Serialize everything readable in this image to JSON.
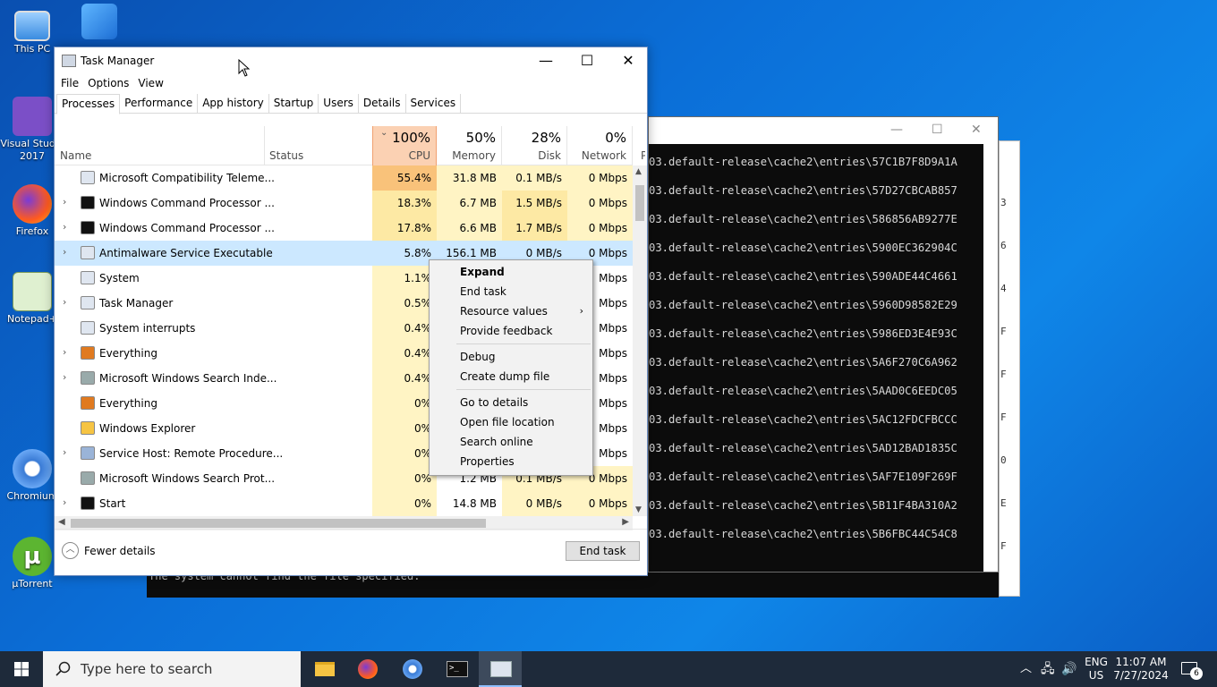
{
  "desktop": {
    "icons": [
      {
        "label": "This PC"
      },
      {
        "label": "Visual Studio 2017"
      },
      {
        "label": "Firefox"
      },
      {
        "label": "Notepad+"
      },
      {
        "label": "Chromium"
      },
      {
        "label": "µTorrent"
      }
    ]
  },
  "console": {
    "lines": [
      "03.default-release\\cache2\\entries\\57C1B7F8D9A1A",
      "03.default-release\\cache2\\entries\\57D27CBCAB857",
      "03.default-release\\cache2\\entries\\586856AB9277E",
      "03.default-release\\cache2\\entries\\5900EC362904C",
      "03.default-release\\cache2\\entries\\590ADE44C4661",
      "03.default-release\\cache2\\entries\\5960D98582E29",
      "03.default-release\\cache2\\entries\\5986ED3E4E93C",
      "03.default-release\\cache2\\entries\\5A6F270C6A962",
      "03.default-release\\cache2\\entries\\5AAD0C6EEDC05",
      "03.default-release\\cache2\\entries\\5AC12FDCFBCCC",
      "03.default-release\\cache2\\entries\\5AD12BAD1835C",
      "03.default-release\\cache2\\entries\\5AF7E109F269F",
      "03.default-release\\cache2\\entries\\5B11F4BA310A2",
      "03.default-release\\cache2\\entries\\5B6FBC44C54C8"
    ],
    "side_chars": [
      "3",
      "6",
      "4",
      "F",
      "F",
      "F",
      "0",
      "E",
      "F"
    ],
    "bottom_text": "The system cannot find the file specified."
  },
  "task_manager": {
    "title": "Task Manager",
    "menu": [
      "File",
      "Options",
      "View"
    ],
    "tabs": [
      "Processes",
      "Performance",
      "App history",
      "Startup",
      "Users",
      "Details",
      "Services"
    ],
    "columns": {
      "name": "Name",
      "status": "Status",
      "cpu_pct": "100%",
      "cpu": "CPU",
      "mem_pct": "50%",
      "mem": "Memory",
      "disk_pct": "28%",
      "disk": "Disk",
      "net_pct": "0%",
      "net": "Network",
      "extra": "P"
    },
    "processes": [
      {
        "name": "Microsoft Compatibility Teleme...",
        "cpu": "55.4%",
        "mem": "31.8 MB",
        "disk": "0.1 MB/s",
        "net": "0 Mbps",
        "expand": false
      },
      {
        "name": "Windows Command Processor ...",
        "cpu": "18.3%",
        "mem": "6.7 MB",
        "disk": "1.5 MB/s",
        "net": "0 Mbps",
        "expand": true
      },
      {
        "name": "Windows Command Processor ...",
        "cpu": "17.8%",
        "mem": "6.6 MB",
        "disk": "1.7 MB/s",
        "net": "0 Mbps",
        "expand": true
      },
      {
        "name": "Antimalware Service Executable",
        "cpu": "5.8%",
        "mem": "156.1 MB",
        "disk": "0 MB/s",
        "net": "0 Mbps",
        "expand": true
      },
      {
        "name": "System",
        "cpu": "1.1%",
        "mem": "",
        "disk": "",
        "net": "Mbps",
        "expand": false
      },
      {
        "name": "Task Manager",
        "cpu": "0.5%",
        "mem": "",
        "disk": "",
        "net": "Mbps",
        "expand": true
      },
      {
        "name": "System interrupts",
        "cpu": "0.4%",
        "mem": "",
        "disk": "",
        "net": "Mbps",
        "expand": false
      },
      {
        "name": "Everything",
        "cpu": "0.4%",
        "mem": "",
        "disk": "",
        "net": "Mbps",
        "expand": true
      },
      {
        "name": "Microsoft Windows Search Inde...",
        "cpu": "0.4%",
        "mem": "",
        "disk": "",
        "net": "Mbps",
        "expand": true
      },
      {
        "name": "Everything",
        "cpu": "0%",
        "mem": "",
        "disk": "",
        "net": "Mbps",
        "expand": false
      },
      {
        "name": "Windows Explorer",
        "cpu": "0%",
        "mem": "",
        "disk": "",
        "net": "Mbps",
        "expand": false
      },
      {
        "name": "Service Host: Remote Procedure...",
        "cpu": "0%",
        "mem": "",
        "disk": "",
        "net": "Mbps",
        "expand": true
      },
      {
        "name": "Microsoft Windows Search Prot...",
        "cpu": "0%",
        "mem": "1.2 MB",
        "disk": "0.1 MB/s",
        "net": "0 Mbps",
        "expand": false
      },
      {
        "name": "Start",
        "cpu": "0%",
        "mem": "14.8 MB",
        "disk": "0 MB/s",
        "net": "0 Mbps",
        "expand": true
      }
    ],
    "fewer_details": "Fewer details",
    "end_task": "End task"
  },
  "context_menu": {
    "items": [
      "Expand",
      "End task",
      "Resource values",
      "Provide feedback",
      "Debug",
      "Create dump file",
      "Go to details",
      "Open file location",
      "Search online",
      "Properties"
    ]
  },
  "taskbar": {
    "search_placeholder": "Type here to search",
    "lang": "ENG",
    "region": "US",
    "time": "11:07 AM",
    "date": "7/27/2024",
    "notification_count": "6"
  },
  "colors": {
    "cpu_hot": "#f9c27a",
    "cpu_warm": "#fde9a4",
    "cpu_cool": "#fff4c4",
    "selected_row": "#cce8ff",
    "cpu_header": "#fbd1b3"
  }
}
